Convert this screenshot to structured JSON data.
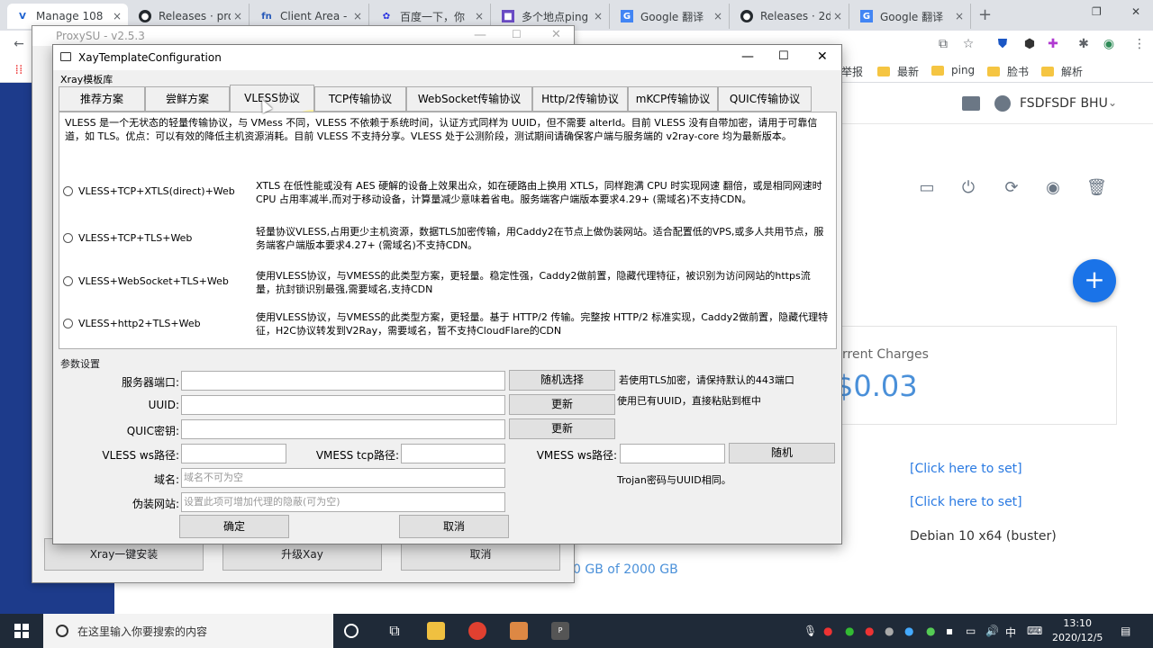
{
  "browser": {
    "tabs": [
      {
        "title": "Manage 108",
        "icon": "V"
      },
      {
        "title": "Releases · pro",
        "icon": "github"
      },
      {
        "title": "Client Area -",
        "icon": "fn"
      },
      {
        "title": "百度一下，你",
        "icon": "baidu"
      },
      {
        "title": "多个地点ping",
        "icon": "ping"
      },
      {
        "title": "Google 翻译",
        "icon": "translate"
      },
      {
        "title": "Releases · 2d",
        "icon": "github"
      },
      {
        "title": "Google 翻译",
        "icon": "translate"
      }
    ],
    "bookmarks": [
      "举报",
      "最新",
      "ping",
      "脸书",
      "解析"
    ]
  },
  "site": {
    "user": "FSDFSDF BHU",
    "charges_label": "rrent Charges",
    "charges_value": "$0.03",
    "link1": "[Click here to set]",
    "link2": "[Click here to set]",
    "os": "Debian 10 x64 (buster)",
    "bandwidth": "0 GB of 2000 GB"
  },
  "proxysu": {
    "title": "ProxySU - v2.5.3",
    "btn_install": "Xray一键安装",
    "btn_upgrade": "升级Xay",
    "btn_cancel": "取消"
  },
  "dialog": {
    "title": "XayTemplateConfiguration",
    "group_label": "Xray模板库",
    "tabs": [
      "推荐方案",
      "尝鲜方案",
      "VLESS协议",
      "TCP传输协议",
      "WebSocket传输协议",
      "Http/2传输协议",
      "mKCP传输协议",
      "QUIC传输协议"
    ],
    "selected_tab": "VLESS协议",
    "description": "VLESS 是一个无状态的轻量传输协议，与 VMess 不同，VLESS 不依赖于系统时间，认证方式同样为 UUID，但不需要 alterId。目前 VLESS 没有自带加密，请用于可靠信道，如 TLS。优点：可以有效的降低主机资源消耗。目前 VLESS 不支持分享。VLESS 处于公测阶段，测试期间请确保客户端与服务端的 v2ray-core 均为最新版本。",
    "options": [
      {
        "label": "VLESS+TCP+XTLS(direct)+Web",
        "desc": "XTLS 在低性能或没有 AES 硬解的设备上效果出众，如在硬路由上换用 XTLS，同样跑满 CPU 时实现网速 翻倍，或是相同网速时CPU 占用率减半,而对于移动设备，计算量减少意味着省电。服务端客户端版本要求4.29+ (需域名)不支持CDN。"
      },
      {
        "label": "VLESS+TCP+TLS+Web",
        "desc": "轻量协议VLESS,占用更少主机资源，数据TLS加密传输，用Caddy2在节点上做伪装网站。适合配置低的VPS,或多人共用节点，服务端客户端版本要求4.27+ (需域名)不支持CDN。"
      },
      {
        "label": "VLESS+WebSocket+TLS+Web",
        "desc": "使用VLESS协议，与VMESS的此类型方案，更轻量。稳定性强，Caddy2做前置，隐藏代理特征，被识别为访问网站的https流量，抗封锁识别最强,需要域名,支持CDN"
      },
      {
        "label": "VLESS+http2+TLS+Web",
        "desc": "使用VLESS协议，与VMESS的此类型方案，更轻量。基于 HTTP/2 传输。完整按 HTTP/2 标准实现，Caddy2做前置，隐藏代理特征，H2C协议转发到V2Ray，需要域名，暂不支持CloudFlare的CDN"
      }
    ],
    "params_label": "参数设置",
    "fields": {
      "port_label": "服务器端口:",
      "uuid_label": "UUID:",
      "quic_label": "QUIC密钥:",
      "vless_ws_label": "VLESS ws路径:",
      "vmess_tcp_label": "VMESS tcp路径:",
      "vmess_ws_label": "VMESS ws路径:",
      "domain_label": "域名:",
      "domain_placeholder": "域名不可为空",
      "fake_label": "伪装网站:",
      "fake_placeholder": "设置此项可增加代理的隐蔽(可为空)"
    },
    "buttons": {
      "random_select": "随机选择",
      "update1": "更新",
      "update2": "更新",
      "random": "随机",
      "ok": "确定",
      "cancel": "取消"
    },
    "notes": {
      "tls_note": "若使用TLS加密，请保持默认的443端口",
      "uuid_note": "使用已有UUID，直接粘贴到框中",
      "trojan_note": "Trojan密码与UUID相同。"
    }
  },
  "taskbar": {
    "search_placeholder": "在这里输入你要搜索的内容",
    "time": "13:10",
    "date": "2020/12/5",
    "ime": "中"
  }
}
